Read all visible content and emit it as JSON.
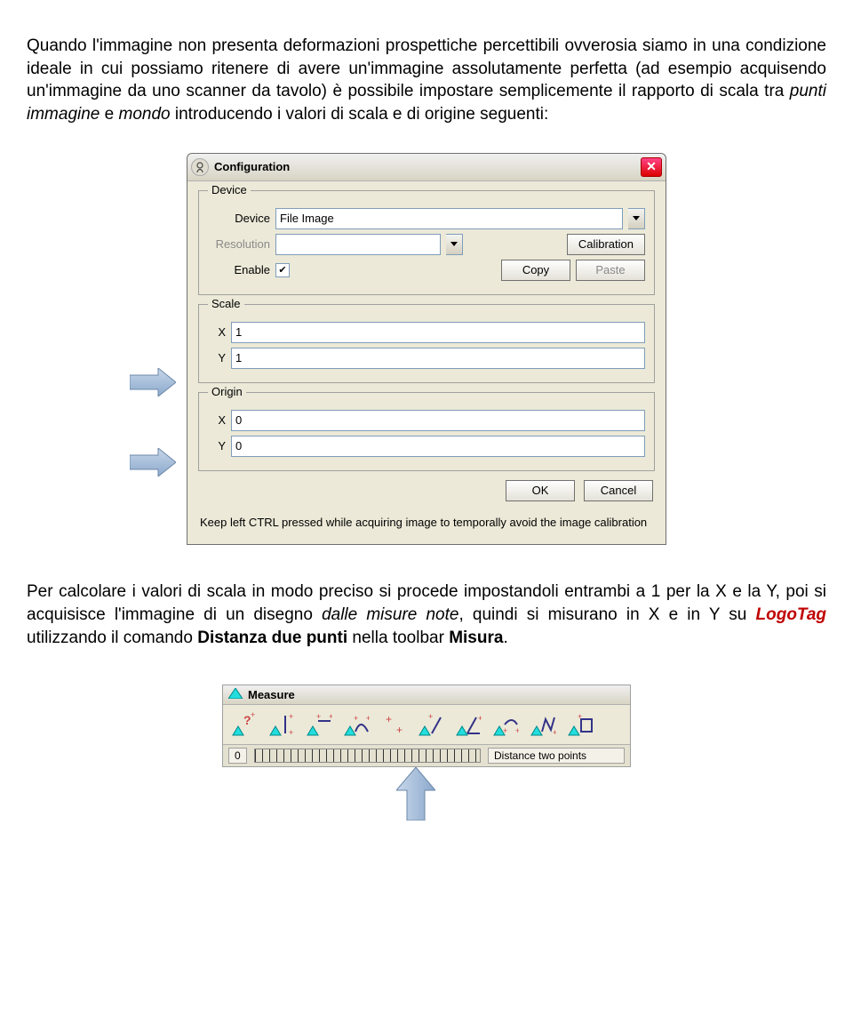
{
  "paragraph1_parts": {
    "p1": "Quando l'immagine non presenta deformazioni prospettiche percettibili ovverosia siamo in una condizione ideale in cui possiamo ritenere di avere un'immagine assolutamente perfetta (ad esempio acquisendo un'immagine da uno scanner da tavolo) è possibile impostare semplicemente il rapporto di scala tra ",
    "p2": "punti immagine",
    "p3": " e ",
    "p4": "mondo",
    "p5": " introducendo i valori di scala e di origine seguenti:"
  },
  "dialog": {
    "title": "Configuration",
    "device_group": "Device",
    "device_label": "Device",
    "device_value": "File Image",
    "resolution_label": "Resolution",
    "calibration_btn": "Calibration",
    "enable_label": "Enable",
    "enable_checked": "✔",
    "copy_btn": "Copy",
    "paste_btn": "Paste",
    "scale_group": "Scale",
    "x_label": "X",
    "y_label": "Y",
    "scale_x": "1",
    "scale_y": "1",
    "origin_group": "Origin",
    "origin_x": "0",
    "origin_y": "0",
    "ok_btn": "OK",
    "cancel_btn": "Cancel",
    "help": "Keep left CTRL pressed while acquiring image to temporally avoid the image calibration"
  },
  "paragraph2_parts": {
    "p1": "Per calcolare i valori di scala in modo preciso si procede impostandoli entrambi a 1 per la X e la Y, poi si acquisisce l'immagine di un disegno ",
    "p2": "dalle misure note",
    "p3": ", quindi si misurano in X e in Y su ",
    "p4": "LogoTag",
    "p5": " utilizzando il comando ",
    "p6": "Distanza due punti",
    "p7": " nella toolbar ",
    "p8": "Misura",
    "p9": "."
  },
  "toolbar": {
    "title": "Measure",
    "status_zero": "0",
    "status_text": "Distance two points"
  }
}
